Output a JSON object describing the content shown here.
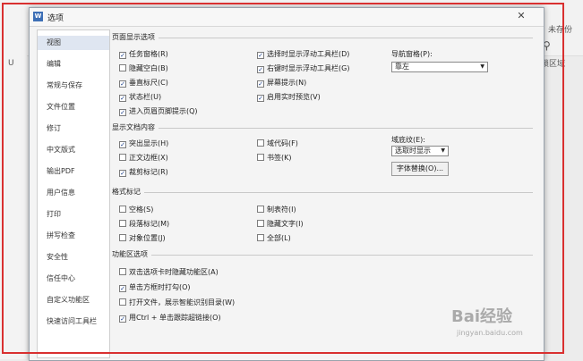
{
  "background": {
    "top_right_text": "未存份",
    "right_btn_text": "锁区域"
  },
  "dialog": {
    "title": "选项",
    "sidebar_items": [
      {
        "label": "视图"
      },
      {
        "label": "编辑"
      },
      {
        "label": "常规与保存"
      },
      {
        "label": "文件位置"
      },
      {
        "label": "修订"
      },
      {
        "label": "中文版式"
      },
      {
        "label": "输出PDF"
      },
      {
        "label": "用户信息"
      },
      {
        "label": "打印"
      },
      {
        "label": "拼写检查"
      },
      {
        "label": "安全性"
      },
      {
        "label": "信任中心"
      },
      {
        "label": "自定义功能区"
      },
      {
        "label": "快速访问工具栏"
      }
    ],
    "sections": {
      "page_display": {
        "title": "页面显示选项",
        "col1": [
          {
            "label": "任务窗格(R)",
            "checked": true
          },
          {
            "label": "隐藏空白(B)",
            "checked": false
          },
          {
            "label": "垂直标尺(C)",
            "checked": true
          },
          {
            "label": "状态栏(U)",
            "checked": true
          },
          {
            "label": "进入页眉页脚提示(Q)",
            "checked": true
          }
        ],
        "col2": [
          {
            "label": "选择时显示浮动工具栏(D)",
            "checked": true
          },
          {
            "label": "右键时显示浮动工具栏(G)",
            "checked": true
          },
          {
            "label": "屏幕提示(N)",
            "checked": true
          },
          {
            "label": "启用实时预览(V)",
            "checked": true
          }
        ],
        "nav_label": "导航窗格(P):",
        "nav_value": "靠左"
      },
      "doc_content": {
        "title": "显示文档内容",
        "col1": [
          {
            "label": "突出显示(H)",
            "checked": true
          },
          {
            "label": "正文边框(X)",
            "checked": false
          },
          {
            "label": "裁剪标记(R)",
            "checked": true
          }
        ],
        "col2": [
          {
            "label": "域代码(F)",
            "checked": false
          },
          {
            "label": "书签(K)",
            "checked": false
          }
        ],
        "field_label": "域底纹(E):",
        "field_value": "选取时显示",
        "font_btn": "字体替换(O)..."
      },
      "format_marks": {
        "title": "格式标记",
        "col1": [
          {
            "label": "空格(S)",
            "checked": false
          },
          {
            "label": "段落标记(M)",
            "checked": false
          },
          {
            "label": "对象位置(J)",
            "checked": false
          }
        ],
        "col2": [
          {
            "label": "制表符(I)",
            "checked": false
          },
          {
            "label": "隐藏文字(I)",
            "checked": false
          },
          {
            "label": "全部(L)",
            "checked": false
          }
        ]
      },
      "ribbon": {
        "title": "功能区选项",
        "items": [
          {
            "label": "双击选项卡时隐藏功能区(A)",
            "checked": false
          },
          {
            "label": "单击方框时打勾(O)",
            "checked": true
          },
          {
            "label": "打开文件，展示智能识别目录(W)",
            "checked": false
          },
          {
            "label": "用Ctrl + 单击跟踪超链接(O)",
            "checked": true
          }
        ]
      }
    }
  },
  "watermark": {
    "brand": "Bai经验",
    "url": "jingyan.baidu.com"
  }
}
